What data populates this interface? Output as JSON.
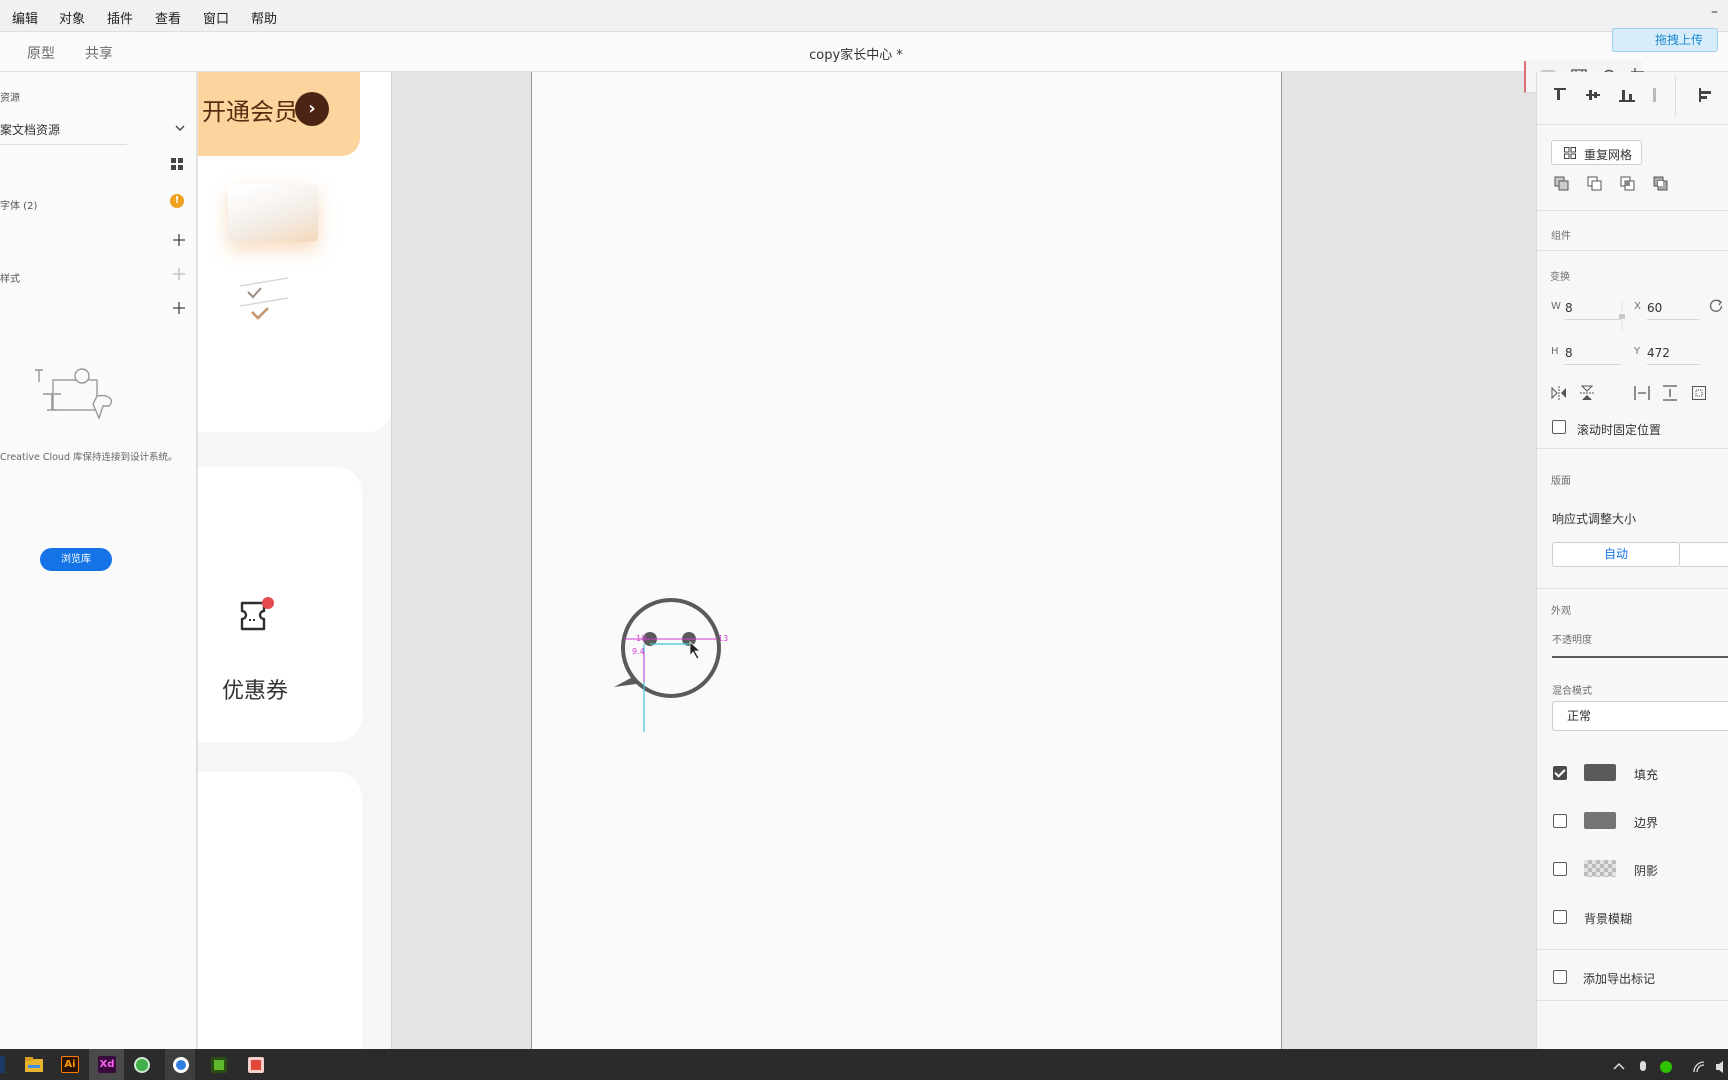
{
  "menubar": {
    "items": [
      "编辑",
      "对象",
      "插件",
      "查看",
      "窗口",
      "帮助"
    ],
    "minimize_glyph": "–"
  },
  "modebar": {
    "tabs": [
      "原型",
      "共享"
    ],
    "document_title": "copy家长中心 *"
  },
  "upload_widget": {
    "label": "拖拽上传"
  },
  "assets_panel": {
    "title": "资源",
    "doc_assets": "案文档资源",
    "fonts_label": "字体 (2)",
    "styles_label": "样式",
    "cc_message": "Creative Cloud 库保持连接到设计系统。",
    "browse_button": "浏览库"
  },
  "artboard_left": {
    "vip_label": "开通会员",
    "coupon_label": "优惠券"
  },
  "canvas": {
    "measure_left": "10",
    "measure_right": "13",
    "measure_vertical": "9.4",
    "icon": "chat-bubble-icon"
  },
  "properties_panel": {
    "repeat_grid": "重复网格",
    "component_label": "组件",
    "transform_label": "变换",
    "w_label": "W",
    "w_value": "8",
    "x_label": "X",
    "x_value": "60",
    "h_label": "H",
    "h_value": "8",
    "y_label": "Y",
    "y_value": "472",
    "fix_position": "滚动时固定位置",
    "layout_label": "版面",
    "responsive_resize": "响应式调整大小",
    "auto_label": "自动",
    "appearance_label": "外观",
    "opacity_label": "不透明度",
    "blend_mode_label": "混合模式",
    "blend_mode_value": "正常",
    "fill_label": "填充",
    "fill_checked": true,
    "fill_color": "#5a5a5a",
    "border_label": "边界",
    "border_checked": false,
    "border_color": "#747474",
    "shadow_label": "阴影",
    "shadow_checked": false,
    "bg_blur_label": "背景模糊",
    "bg_blur_checked": false,
    "export_mark": "添加导出标记"
  },
  "colors": {
    "accent": "#1473e6",
    "measure_magenta": "#d23bd2",
    "measure_cyan": "#3fc7d4",
    "vip_bg": "#fbd49e",
    "vip_dark": "#4b2414",
    "warning": "#f0a020",
    "badge_red": "#e5484d"
  },
  "taskbar": {
    "apps": [
      "ps-icon",
      "file-explorer-icon",
      "illustrator-icon",
      "xd-icon",
      "browser-green-icon",
      "chrome-icon",
      "camtasia-green-icon",
      "camtasia-red-icon"
    ],
    "ai_label": "Ai",
    "xd_label": "Xd"
  }
}
